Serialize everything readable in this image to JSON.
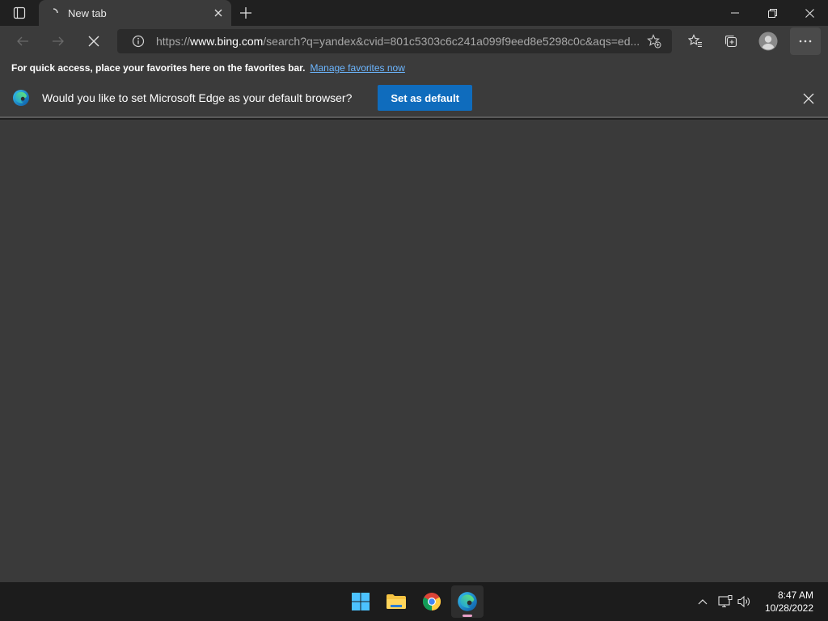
{
  "window": {
    "tab_title": "New tab"
  },
  "toolbar": {
    "url_prefix": "https://",
    "url_host": "www.bing.com",
    "url_path": "/search?q=yandex&cvid=801c5303c6c241a099f9eed8e5298c0c&aqs=ed..."
  },
  "favorites_bar": {
    "hint": "For quick access, place your favorites here on the favorites bar.",
    "link": "Manage favorites now"
  },
  "infobar": {
    "message": "Would you like to set Microsoft Edge as your default browser?",
    "button": "Set as default"
  },
  "taskbar": {
    "apps": [
      "start-icon",
      "file-explorer-icon",
      "chrome-icon",
      "edge-icon"
    ],
    "time": "8:47 AM",
    "date": "10/28/2022"
  },
  "colors": {
    "accent": "#0f6cbd",
    "link": "#6cb6ff",
    "chrome_bg": "#3b3b3b",
    "page_bg": "#3a3a3a",
    "taskbar_bg": "#1c1c1c"
  }
}
